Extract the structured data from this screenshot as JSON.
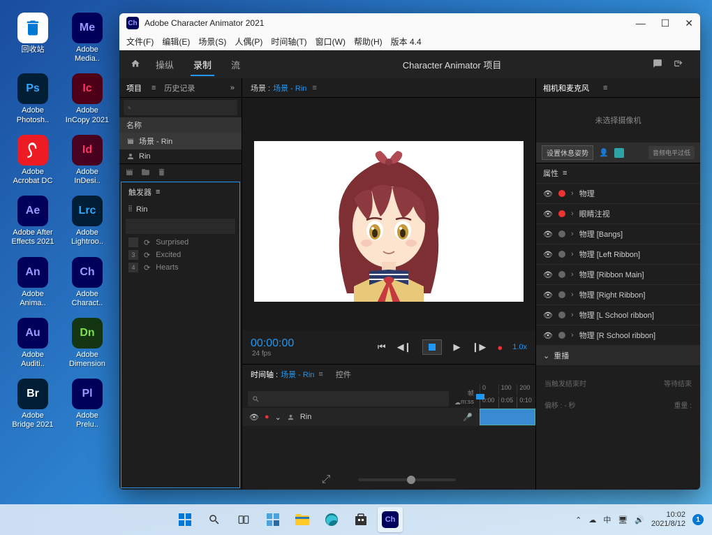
{
  "desktop": {
    "icons": [
      {
        "label": "回收站",
        "cls": "recycle"
      },
      {
        "label": "Adobe\nMedia..",
        "cls": "me",
        "abbr": "Me"
      },
      {
        "label": "Adobe\nPhotosh..",
        "cls": "ps",
        "abbr": "Ps"
      },
      {
        "label": "Adobe\nInCopy 2021",
        "cls": "ic",
        "abbr": "Ic"
      },
      {
        "label": "Adobe\nAcrobat DC",
        "cls": "acrobat",
        "abbr": ""
      },
      {
        "label": "Adobe\nInDesi..",
        "cls": "id",
        "abbr": "Id"
      },
      {
        "label": "Adobe After\nEffects 2021",
        "cls": "ae",
        "abbr": "Ae"
      },
      {
        "label": "Adobe\nLightroo..",
        "cls": "lrc",
        "abbr": "Lrc"
      },
      {
        "label": "Adobe\nAnima..",
        "cls": "an",
        "abbr": "An"
      },
      {
        "label": "Adobe\nCharact..",
        "cls": "ch-i",
        "abbr": "Ch"
      },
      {
        "label": "Adobe\nAuditi..",
        "cls": "au",
        "abbr": "Au"
      },
      {
        "label": "Adobe\nDimension",
        "cls": "dn",
        "abbr": "Dn"
      },
      {
        "label": "Adobe\nBridge 2021",
        "cls": "br",
        "abbr": "Br"
      },
      {
        "label": "Adobe\nPrelu..",
        "cls": "pl",
        "abbr": "Pl"
      }
    ]
  },
  "app": {
    "title": "Adobe Character Animator 2021",
    "menubar": [
      "文件(F)",
      "编辑(E)",
      "场景(S)",
      "人偶(P)",
      "时间轴(T)",
      "窗口(W)",
      "帮助(H)",
      "版本 4.4"
    ],
    "toolbar": {
      "modes": [
        {
          "label": "操纵",
          "active": false
        },
        {
          "label": "录制",
          "active": true
        },
        {
          "label": "流",
          "active": false
        }
      ],
      "title": "Character Animator 项目"
    },
    "left": {
      "tabs": {
        "project": "项目",
        "history": "历史记录"
      },
      "header": "名称",
      "items": [
        {
          "label": "场景 - Rin",
          "type": "scene",
          "selected": true
        },
        {
          "label": "Rin",
          "type": "puppet",
          "selected": false
        }
      ],
      "triggers": {
        "title": "触发器",
        "puppet_name": "Rin",
        "list": [
          {
            "num": "",
            "label": "Surprised"
          },
          {
            "num": "3",
            "label": "Excited"
          },
          {
            "num": "4",
            "label": "Hearts"
          }
        ]
      }
    },
    "center": {
      "scene_prefix": "场景 :",
      "scene_name": "场景 - Rin",
      "timecode": "00:00:00",
      "fps": "24 fps",
      "speed": "1.0x",
      "timeline": {
        "title": "时间轴 :",
        "scene": "场景 - Rin",
        "controls": "控件",
        "frame_label": "帧",
        "mss_label": "m:ss",
        "frames": [
          "0",
          "100",
          "200"
        ],
        "mss": [
          "0:00",
          "0:05",
          "0:10"
        ],
        "track": "Rin"
      }
    },
    "right": {
      "panel": "相机和麦克风",
      "no_cam": "未选择摄像机",
      "rest_pose": "设置休息姿势",
      "audio_low": "音频电平过低",
      "attrs_title": "属性",
      "attrs": [
        {
          "name": "物理",
          "live": true
        },
        {
          "name": "眼睛注视",
          "live": true
        },
        {
          "name": "物理 [Bangs]",
          "live": false
        },
        {
          "name": "物理 [Left Ribbon]",
          "live": false
        },
        {
          "name": "物理 [Ribbon Main]",
          "live": false
        },
        {
          "name": "物理 [Right Ribbon]",
          "live": false
        },
        {
          "name": "物理 [L School ribbon]",
          "live": false
        },
        {
          "name": "物理 [R School ribbon]",
          "live": false
        }
      ],
      "replay": "重播",
      "wait_label": "当触发结束时",
      "wait_value": "等待结束",
      "offset_label": "偏移 :",
      "offset_value": "- 秒",
      "weight_label": "重量 :"
    }
  },
  "taskbar": {
    "time": "10:02",
    "date": "2021/8/12",
    "ime": "中",
    "notif": "1"
  }
}
